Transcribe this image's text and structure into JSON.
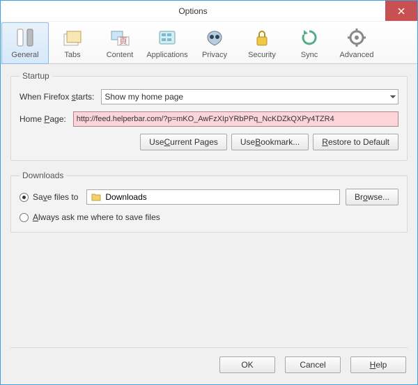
{
  "window": {
    "title": "Options"
  },
  "toolbar": {
    "items": [
      {
        "label": "General"
      },
      {
        "label": "Tabs"
      },
      {
        "label": "Content"
      },
      {
        "label": "Applications"
      },
      {
        "label": "Privacy"
      },
      {
        "label": "Security"
      },
      {
        "label": "Sync"
      },
      {
        "label": "Advanced"
      }
    ]
  },
  "startup": {
    "legend": "Startup",
    "when_label_pre": "When Firefox ",
    "when_label_under": "s",
    "when_label_post": "tarts:",
    "when_value": "Show my home page",
    "home_label_pre": "Home ",
    "home_label_under": "P",
    "home_label_post": "age:",
    "home_value": "http://feed.helperbar.com/?p=mKO_AwFzXIpYRbPPq_NcKDZkQXPy4TZR4",
    "btn_current_pre": "Use ",
    "btn_current_under": "C",
    "btn_current_post": "urrent Pages",
    "btn_bookmark_pre": "Use ",
    "btn_bookmark_under": "B",
    "btn_bookmark_post": "ookmark...",
    "btn_restore_under": "R",
    "btn_restore_post": "estore to Default"
  },
  "downloads": {
    "legend": "Downloads",
    "save_label_pre": "Sa",
    "save_label_under": "v",
    "save_label_post": "e files to",
    "path": "Downloads",
    "browse_pre": "Br",
    "browse_under": "o",
    "browse_post": "wse...",
    "always_under": "A",
    "always_post": "lways ask me where to save files"
  },
  "footer": {
    "ok": "OK",
    "cancel": "Cancel",
    "help_under": "H",
    "help_post": "elp"
  }
}
